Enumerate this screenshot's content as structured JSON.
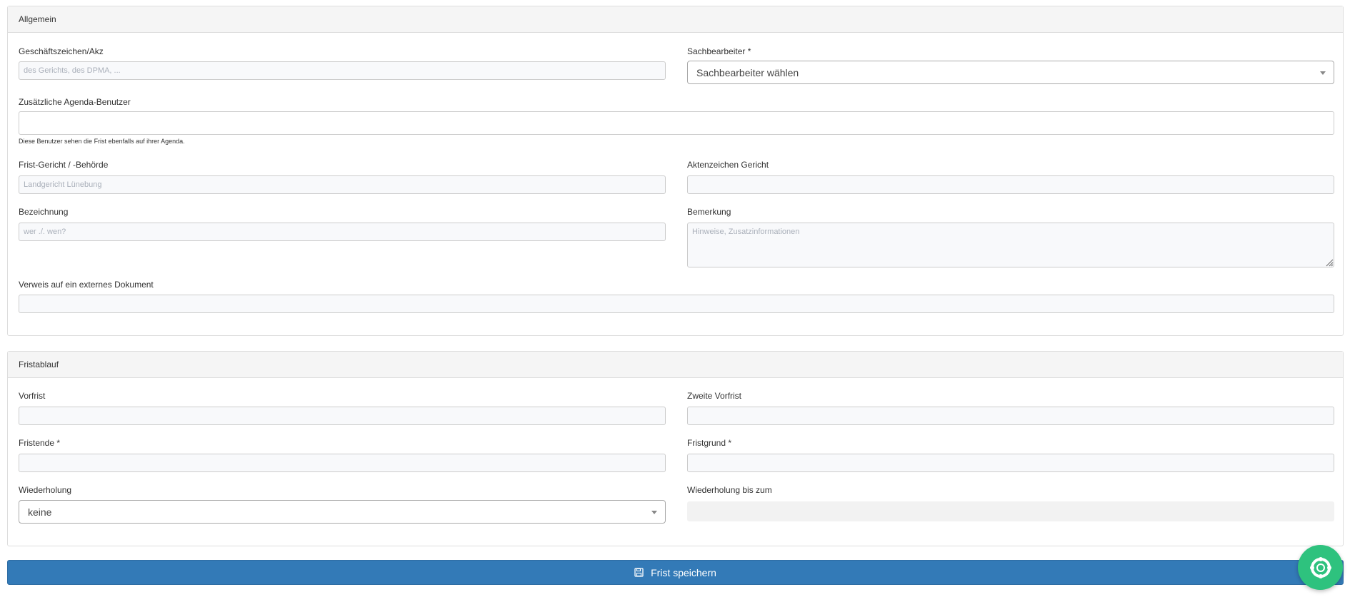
{
  "allgemein": {
    "title": "Allgemein",
    "geschaeftszeichen": {
      "label": "Geschäftszeichen/Akz",
      "placeholder": "des Gerichts, des DPMA, ..."
    },
    "sachbearbeiter": {
      "label": "Sachbearbeiter *",
      "selected": "Sachbearbeiter wählen"
    },
    "agenda_benutzer": {
      "label": "Zusätzliche Agenda-Benutzer",
      "help": "Diese Benutzer sehen die Frist ebenfalls auf ihrer Agenda."
    },
    "frist_gericht": {
      "label": "Frist-Gericht / -Behörde",
      "placeholder": "Landgericht Lünebung"
    },
    "aktenzeichen_gericht": {
      "label": "Aktenzeichen Gericht",
      "placeholder": ""
    },
    "bezeichnung": {
      "label": "Bezeichnung",
      "placeholder": "wer ./. wen?"
    },
    "bemerkung": {
      "label": "Bemerkung",
      "placeholder": "Hinweise, Zusatzinformationen"
    },
    "verweis": {
      "label": "Verweis auf ein externes Dokument",
      "placeholder": ""
    }
  },
  "fristablauf": {
    "title": "Fristablauf",
    "vorfrist": {
      "label": "Vorfrist"
    },
    "zweite_vorfrist": {
      "label": "Zweite Vorfrist"
    },
    "fristende": {
      "label": "Fristende *"
    },
    "fristgrund": {
      "label": "Fristgrund *"
    },
    "wiederholung": {
      "label": "Wiederholung",
      "selected": "keine"
    },
    "wiederholung_bis": {
      "label": "Wiederholung bis zum"
    }
  },
  "actions": {
    "save_label": "Frist speichern",
    "save_icon": "floppy-disk-icon",
    "chat_icon": "lifebuoy-icon"
  },
  "colors": {
    "primary": "#337ab7",
    "fab": "#2ec27e"
  }
}
